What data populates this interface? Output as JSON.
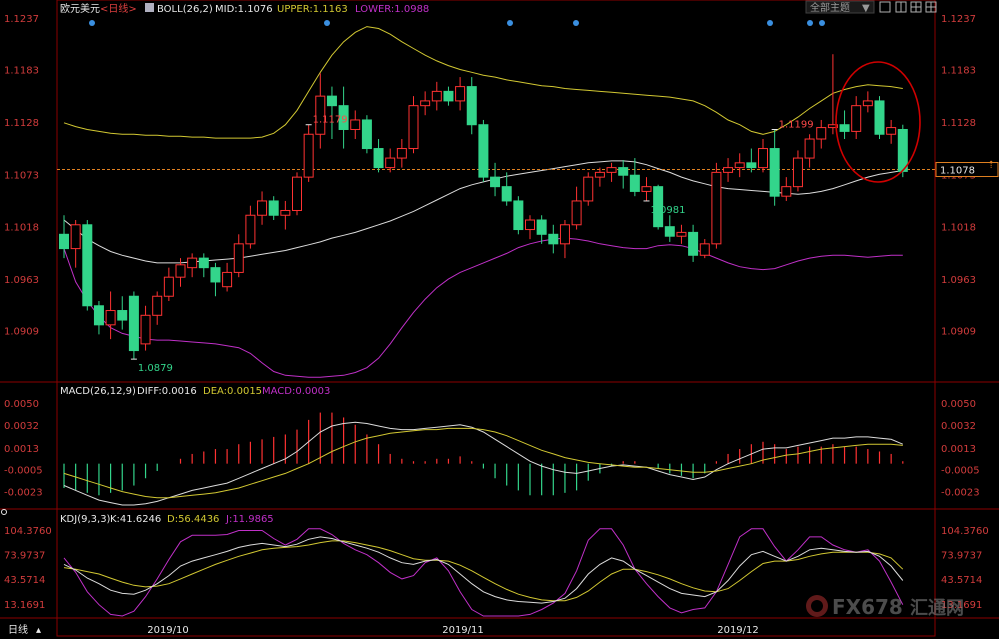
{
  "instrument": "欧元美元",
  "period_tag": "<日线>",
  "toolbar": {
    "theme_label": "全部主题",
    "dropdown_glyph": "▼"
  },
  "footer": {
    "period_label": "日线",
    "watermark": "FX678",
    "watermark_cn": "汇通网"
  },
  "colors": {
    "up": "#ff3232",
    "down": "#33d58b",
    "upper": "#d2c832",
    "mid": "#dcdcdc",
    "lower": "#c030c8",
    "diff": "#dcdcdc",
    "dea": "#d2c832",
    "k": "#dcdcdc",
    "d": "#d2c832",
    "j": "#c030c8",
    "highlight": "#d00000"
  },
  "chart_data": [
    {
      "type": "candlestick",
      "title": "BOLL(26,2)",
      "legend": {
        "mid": "MID:1.1076",
        "upper": "UPPER:1.1163",
        "lower": "LOWER:1.0988"
      },
      "ylim": [
        1.0855,
        1.1237
      ],
      "y_ticks": [
        "1.1237",
        "1.1183",
        "1.1128",
        "1.1073",
        "1.1018",
        "1.0963",
        "1.0909"
      ],
      "current_price": "1.1078",
      "x_labels": [
        "2019/10",
        "2019/11",
        "2019/12"
      ],
      "annotations": [
        {
          "text": "1.1179",
          "index": 21,
          "kind": "high"
        },
        {
          "text": "1.0879",
          "index": 6,
          "kind": "low"
        },
        {
          "text": "1.0981",
          "index": 50,
          "kind": "low"
        },
        {
          "text": "1.1199",
          "index": 61,
          "kind": "high"
        }
      ],
      "candles": [
        {
          "o": 1.101,
          "h": 1.103,
          "c": 1.0995,
          "l": 1.0985
        },
        {
          "o": 1.0995,
          "h": 1.1025,
          "c": 1.102,
          "l": 1.0975
        },
        {
          "o": 1.102,
          "h": 1.1025,
          "c": 1.0935,
          "l": 1.093
        },
        {
          "o": 1.0935,
          "h": 1.094,
          "c": 1.0915,
          "l": 1.0905
        },
        {
          "o": 1.0915,
          "h": 1.095,
          "c": 1.093,
          "l": 1.09
        },
        {
          "o": 1.093,
          "h": 1.0945,
          "c": 1.092,
          "l": 1.091
        },
        {
          "o": 1.0945,
          "h": 1.095,
          "c": 1.0888,
          "l": 1.0879
        },
        {
          "o": 1.0895,
          "h": 1.0935,
          "c": 1.0925,
          "l": 1.0888
        },
        {
          "o": 1.0925,
          "h": 1.095,
          "c": 1.0945,
          "l": 1.0915
        },
        {
          "o": 1.0945,
          "h": 1.0975,
          "c": 1.0965,
          "l": 1.094
        },
        {
          "o": 1.0965,
          "h": 1.0985,
          "c": 1.0978,
          "l": 1.0955
        },
        {
          "o": 1.0975,
          "h": 1.099,
          "c": 1.0985,
          "l": 1.0965
        },
        {
          "o": 1.0985,
          "h": 1.099,
          "c": 1.0975,
          "l": 1.0965
        },
        {
          "o": 1.0975,
          "h": 1.098,
          "c": 1.096,
          "l": 1.0945
        },
        {
          "o": 1.0955,
          "h": 1.098,
          "c": 1.097,
          "l": 1.095
        },
        {
          "o": 1.097,
          "h": 1.101,
          "c": 1.1,
          "l": 1.0965
        },
        {
          "o": 1.1,
          "h": 1.104,
          "c": 1.103,
          "l": 1.0995
        },
        {
          "o": 1.103,
          "h": 1.1055,
          "c": 1.1045,
          "l": 1.102
        },
        {
          "o": 1.1045,
          "h": 1.105,
          "c": 1.103,
          "l": 1.1025
        },
        {
          "o": 1.103,
          "h": 1.1045,
          "c": 1.1035,
          "l": 1.1015
        },
        {
          "o": 1.1035,
          "h": 1.1075,
          "c": 1.107,
          "l": 1.103
        },
        {
          "o": 1.107,
          "h": 1.1125,
          "c": 1.1115,
          "l": 1.1065
        },
        {
          "o": 1.1115,
          "h": 1.1179,
          "c": 1.1155,
          "l": 1.11
        },
        {
          "o": 1.1155,
          "h": 1.1165,
          "c": 1.1145,
          "l": 1.111
        },
        {
          "o": 1.1145,
          "h": 1.1165,
          "c": 1.112,
          "l": 1.11
        },
        {
          "o": 1.112,
          "h": 1.114,
          "c": 1.113,
          "l": 1.111
        },
        {
          "o": 1.113,
          "h": 1.1135,
          "c": 1.11,
          "l": 1.1095
        },
        {
          "o": 1.11,
          "h": 1.111,
          "c": 1.108,
          "l": 1.1075
        },
        {
          "o": 1.108,
          "h": 1.11,
          "c": 1.109,
          "l": 1.1075
        },
        {
          "o": 1.109,
          "h": 1.111,
          "c": 1.11,
          "l": 1.108
        },
        {
          "o": 1.11,
          "h": 1.1155,
          "c": 1.1145,
          "l": 1.1095
        },
        {
          "o": 1.1145,
          "h": 1.116,
          "c": 1.115,
          "l": 1.1135
        },
        {
          "o": 1.115,
          "h": 1.117,
          "c": 1.116,
          "l": 1.114
        },
        {
          "o": 1.116,
          "h": 1.1165,
          "c": 1.115,
          "l": 1.1145
        },
        {
          "o": 1.115,
          "h": 1.1175,
          "c": 1.1165,
          "l": 1.114
        },
        {
          "o": 1.1165,
          "h": 1.1175,
          "c": 1.1125,
          "l": 1.1115
        },
        {
          "o": 1.1125,
          "h": 1.113,
          "c": 1.107,
          "l": 1.1065
        },
        {
          "o": 1.107,
          "h": 1.1085,
          "c": 1.106,
          "l": 1.105
        },
        {
          "o": 1.106,
          "h": 1.1075,
          "c": 1.1045,
          "l": 1.104
        },
        {
          "o": 1.1045,
          "h": 1.105,
          "c": 1.1015,
          "l": 1.101
        },
        {
          "o": 1.1015,
          "h": 1.103,
          "c": 1.1025,
          "l": 1.1005
        },
        {
          "o": 1.1025,
          "h": 1.103,
          "c": 1.101,
          "l": 1.1
        },
        {
          "o": 1.101,
          "h": 1.102,
          "c": 1.1,
          "l": 1.099
        },
        {
          "o": 1.1,
          "h": 1.1025,
          "c": 1.102,
          "l": 1.0985
        },
        {
          "o": 1.102,
          "h": 1.106,
          "c": 1.1045,
          "l": 1.1015
        },
        {
          "o": 1.1045,
          "h": 1.1075,
          "c": 1.107,
          "l": 1.104
        },
        {
          "o": 1.107,
          "h": 1.108,
          "c": 1.1075,
          "l": 1.106
        },
        {
          "o": 1.1075,
          "h": 1.1085,
          "c": 1.108,
          "l": 1.1065
        },
        {
          "o": 1.108,
          "h": 1.1088,
          "c": 1.1072,
          "l": 1.1058
        },
        {
          "o": 1.1072,
          "h": 1.109,
          "c": 1.1055,
          "l": 1.105
        },
        {
          "o": 1.1055,
          "h": 1.107,
          "c": 1.106,
          "l": 1.1045
        },
        {
          "o": 1.106,
          "h": 1.1062,
          "c": 1.1018,
          "l": 1.1015
        },
        {
          "o": 1.1018,
          "h": 1.103,
          "c": 1.1008,
          "l": 1.1002
        },
        {
          "o": 1.1008,
          "h": 1.102,
          "c": 1.1012,
          "l": 1.1
        },
        {
          "o": 1.1012,
          "h": 1.102,
          "c": 1.0988,
          "l": 1.0981
        },
        {
          "o": 1.0988,
          "h": 1.1005,
          "c": 1.1,
          "l": 1.0985
        },
        {
          "o": 1.1,
          "h": 1.1085,
          "c": 1.1075,
          "l": 1.0995
        },
        {
          "o": 1.1075,
          "h": 1.109,
          "c": 1.108,
          "l": 1.1065
        },
        {
          "o": 1.108,
          "h": 1.1095,
          "c": 1.1085,
          "l": 1.107
        },
        {
          "o": 1.1085,
          "h": 1.11,
          "c": 1.108,
          "l": 1.1075
        },
        {
          "o": 1.108,
          "h": 1.111,
          "c": 1.11,
          "l": 1.1075
        },
        {
          "o": 1.11,
          "h": 1.112,
          "c": 1.105,
          "l": 1.104
        },
        {
          "o": 1.105,
          "h": 1.107,
          "c": 1.106,
          "l": 1.1045
        },
        {
          "o": 1.106,
          "h": 1.1098,
          "c": 1.109,
          "l": 1.1055
        },
        {
          "o": 1.109,
          "h": 1.1115,
          "c": 1.111,
          "l": 1.108
        },
        {
          "o": 1.111,
          "h": 1.113,
          "c": 1.1122,
          "l": 1.11
        },
        {
          "o": 1.1122,
          "h": 1.1199,
          "c": 1.1125,
          "l": 1.1115
        },
        {
          "o": 1.1125,
          "h": 1.114,
          "c": 1.1118,
          "l": 1.111
        },
        {
          "o": 1.1118,
          "h": 1.1155,
          "c": 1.1145,
          "l": 1.111
        },
        {
          "o": 1.1145,
          "h": 1.116,
          "c": 1.115,
          "l": 1.1138
        },
        {
          "o": 1.115,
          "h": 1.1155,
          "c": 1.1115,
          "l": 1.111
        },
        {
          "o": 1.1115,
          "h": 1.113,
          "c": 1.1122,
          "l": 1.1105
        },
        {
          "o": 1.112,
          "h": 1.1125,
          "c": 1.1076,
          "l": 1.107
        }
      ],
      "boll_mid": [
        1.1025,
        1.1015,
        1.1005,
        1.0998,
        1.0992,
        1.0988,
        1.0985,
        1.0982,
        1.098,
        1.098,
        1.098,
        1.0981,
        1.0982,
        1.0983,
        1.0984,
        1.0985,
        1.0987,
        1.0989,
        1.0991,
        1.0993,
        1.0996,
        1.0999,
        1.1002,
        1.1006,
        1.1009,
        1.1012,
        1.1016,
        1.102,
        1.1024,
        1.1029,
        1.1034,
        1.104,
        1.1046,
        1.1052,
        1.1058,
        1.1062,
        1.1065,
        1.1068,
        1.1071,
        1.1073,
        1.1075,
        1.1077,
        1.1079,
        1.1081,
        1.1083,
        1.1085,
        1.1086,
        1.1087,
        1.1087,
        1.1086,
        1.1083,
        1.1079,
        1.1075,
        1.107,
        1.1066,
        1.1063,
        1.106,
        1.1058,
        1.1057,
        1.1056,
        1.1055,
        1.1054,
        1.1053,
        1.1052,
        1.1053,
        1.1055,
        1.1058,
        1.1062,
        1.1066,
        1.107,
        1.1073,
        1.1075,
        1.1077
      ],
      "boll_upper": [
        1.1127,
        1.1123,
        1.112,
        1.1118,
        1.1116,
        1.1115,
        1.1115,
        1.1114,
        1.1114,
        1.1113,
        1.1113,
        1.1112,
        1.1112,
        1.1111,
        1.1111,
        1.1111,
        1.1111,
        1.1112,
        1.1116,
        1.1125,
        1.114,
        1.116,
        1.118,
        1.1198,
        1.1212,
        1.1222,
        1.1228,
        1.1226,
        1.122,
        1.1212,
        1.1205,
        1.1198,
        1.1192,
        1.1187,
        1.1183,
        1.118,
        1.1177,
        1.1175,
        1.1172,
        1.117,
        1.1168,
        1.1166,
        1.1165,
        1.1163,
        1.1162,
        1.1161,
        1.116,
        1.1159,
        1.1158,
        1.1157,
        1.1156,
        1.1155,
        1.1154,
        1.1152,
        1.115,
        1.1145,
        1.1138,
        1.113,
        1.1125,
        1.1118,
        1.1115,
        1.1118,
        1.1125,
        1.1133,
        1.1142,
        1.115,
        1.1158,
        1.1162,
        1.1165,
        1.1167,
        1.1166,
        1.1165,
        1.1163
      ],
      "boll_lower": [
        1.0995,
        1.096,
        1.094,
        1.0924,
        1.0912,
        1.0906,
        1.0903,
        1.09,
        1.0899,
        1.0899,
        1.0898,
        1.0897,
        1.0896,
        1.0895,
        1.0893,
        1.0891,
        1.0885,
        1.0875,
        1.0866,
        1.0862,
        1.0861,
        1.086,
        1.086,
        1.0861,
        1.0862,
        1.0865,
        1.087,
        1.088,
        1.0895,
        1.0912,
        1.0928,
        1.0942,
        1.0954,
        1.0963,
        1.097,
        1.0975,
        1.098,
        1.0985,
        1.099,
        1.0996,
        1.1,
        1.1003,
        1.1005,
        1.1006,
        1.1005,
        1.1003,
        1.1,
        1.0998,
        1.0996,
        1.0995,
        1.0995,
        1.0998,
        1.0999,
        1.0998,
        1.0995,
        1.099,
        1.0985,
        1.098,
        1.0976,
        1.0974,
        1.0973,
        1.0974,
        1.0978,
        1.0982,
        1.0985,
        1.0987,
        1.0988,
        1.0988,
        1.0987,
        1.0986,
        1.0987,
        1.0988,
        1.0988
      ]
    },
    {
      "type": "macd",
      "title": "MACD(26,12,9)",
      "legend": {
        "diff": "DIFF:0.0016",
        "dea": "DEA:0.0015",
        "macd": "MACD:0.0003"
      },
      "ylim": [
        -0.0034,
        0.0054
      ],
      "y_ticks": [
        "0.0050",
        "0.0032",
        "0.0013",
        "-0.0005",
        "-0.0023"
      ],
      "diff": [
        -0.0018,
        -0.0022,
        -0.0026,
        -0.003,
        -0.0032,
        -0.0034,
        -0.0034,
        -0.0033,
        -0.0031,
        -0.0028,
        -0.0025,
        -0.0022,
        -0.002,
        -0.0018,
        -0.0016,
        -0.0012,
        -0.0008,
        -0.0004,
        0.0,
        0.0004,
        0.001,
        0.0018,
        0.0026,
        0.0031,
        0.0033,
        0.0034,
        0.0033,
        0.0031,
        0.0029,
        0.0028,
        0.0028,
        0.0029,
        0.003,
        0.0031,
        0.0032,
        0.003,
        0.0026,
        0.002,
        0.0014,
        0.0008,
        0.0002,
        -0.0002,
        -0.0005,
        -0.0007,
        -0.0008,
        -0.0006,
        -0.0004,
        -0.0002,
        -0.0001,
        -0.0002,
        -0.0003,
        -0.0006,
        -0.0009,
        -0.0011,
        -0.0013,
        -0.0011,
        -0.0005,
        0.0,
        0.0004,
        0.0008,
        0.0012,
        0.0013,
        0.0013,
        0.0015,
        0.0017,
        0.0019,
        0.0021,
        0.0021,
        0.0022,
        0.0022,
        0.0021,
        0.002,
        0.0016
      ],
      "dea": [
        -0.0008,
        -0.0011,
        -0.0014,
        -0.0017,
        -0.002,
        -0.0023,
        -0.0025,
        -0.0027,
        -0.0028,
        -0.0028,
        -0.0027,
        -0.0026,
        -0.0025,
        -0.0024,
        -0.0022,
        -0.002,
        -0.0017,
        -0.0014,
        -0.0011,
        -0.0008,
        -0.0004,
        0.0,
        0.0005,
        0.001,
        0.0014,
        0.0018,
        0.0021,
        0.0023,
        0.0025,
        0.0026,
        0.0027,
        0.0028,
        0.0028,
        0.0029,
        0.0029,
        0.0029,
        0.0028,
        0.0026,
        0.0023,
        0.0019,
        0.0015,
        0.0011,
        0.0008,
        0.0005,
        0.0003,
        0.0001,
        0.0,
        -0.0001,
        -0.0002,
        -0.0003,
        -0.0003,
        -0.0004,
        -0.0005,
        -0.0006,
        -0.0007,
        -0.0007,
        -0.0006,
        -0.0004,
        -0.0002,
        0.0,
        0.0003,
        0.0005,
        0.0007,
        0.0008,
        0.001,
        0.0012,
        0.0013,
        0.0014,
        0.0015,
        0.0016,
        0.0016,
        0.0016,
        0.0015
      ]
    },
    {
      "type": "kdj",
      "title": "KDJ(9,3,3)",
      "legend": {
        "k": "K:41.6246",
        "d": "D:56.4436",
        "j": "J:11.9865"
      },
      "ylim": [
        -2,
        112
      ],
      "y_ticks": [
        "104.3760",
        "73.9737",
        "43.5714",
        "13.1691"
      ],
      "k": [
        62,
        55,
        45,
        38,
        30,
        26,
        25,
        30,
        38,
        48,
        60,
        66,
        70,
        74,
        78,
        83,
        86,
        88,
        86,
        84,
        87,
        93,
        96,
        94,
        90,
        86,
        82,
        77,
        70,
        64,
        62,
        66,
        68,
        62,
        50,
        38,
        28,
        22,
        18,
        16,
        15,
        14,
        16,
        20,
        32,
        50,
        62,
        70,
        66,
        56,
        48,
        40,
        32,
        26,
        24,
        22,
        28,
        42,
        60,
        74,
        78,
        72,
        66,
        72,
        80,
        82,
        80,
        78,
        77,
        78,
        72,
        60,
        42
      ],
      "d": [
        58,
        56,
        53,
        50,
        45,
        40,
        36,
        34,
        35,
        38,
        44,
        50,
        56,
        62,
        67,
        72,
        76,
        80,
        82,
        83,
        84,
        86,
        89,
        91,
        91,
        89,
        86,
        83,
        79,
        74,
        69,
        67,
        67,
        66,
        61,
        54,
        46,
        38,
        31,
        25,
        21,
        18,
        17,
        17,
        21,
        29,
        40,
        50,
        56,
        56,
        53,
        49,
        44,
        38,
        33,
        29,
        28,
        32,
        42,
        53,
        63,
        66,
        66,
        68,
        72,
        75,
        77,
        77,
        77,
        77,
        75,
        70,
        56
      ],
      "j": [
        70,
        52,
        28,
        12,
        0,
        -2,
        4,
        22,
        44,
        68,
        90,
        98,
        98,
        98,
        99,
        104,
        104,
        104,
        94,
        86,
        93,
        106,
        106,
        99,
        88,
        80,
        74,
        64,
        52,
        44,
        48,
        64,
        70,
        54,
        28,
        6,
        -2,
        -2,
        -2,
        -2,
        0,
        6,
        14,
        26,
        54,
        92,
        106,
        106,
        86,
        56,
        38,
        22,
        8,
        2,
        6,
        8,
        28,
        62,
        96,
        106,
        106,
        84,
        66,
        80,
        96,
        96,
        86,
        80,
        77,
        80,
        66,
        40,
        12
      ]
    }
  ]
}
